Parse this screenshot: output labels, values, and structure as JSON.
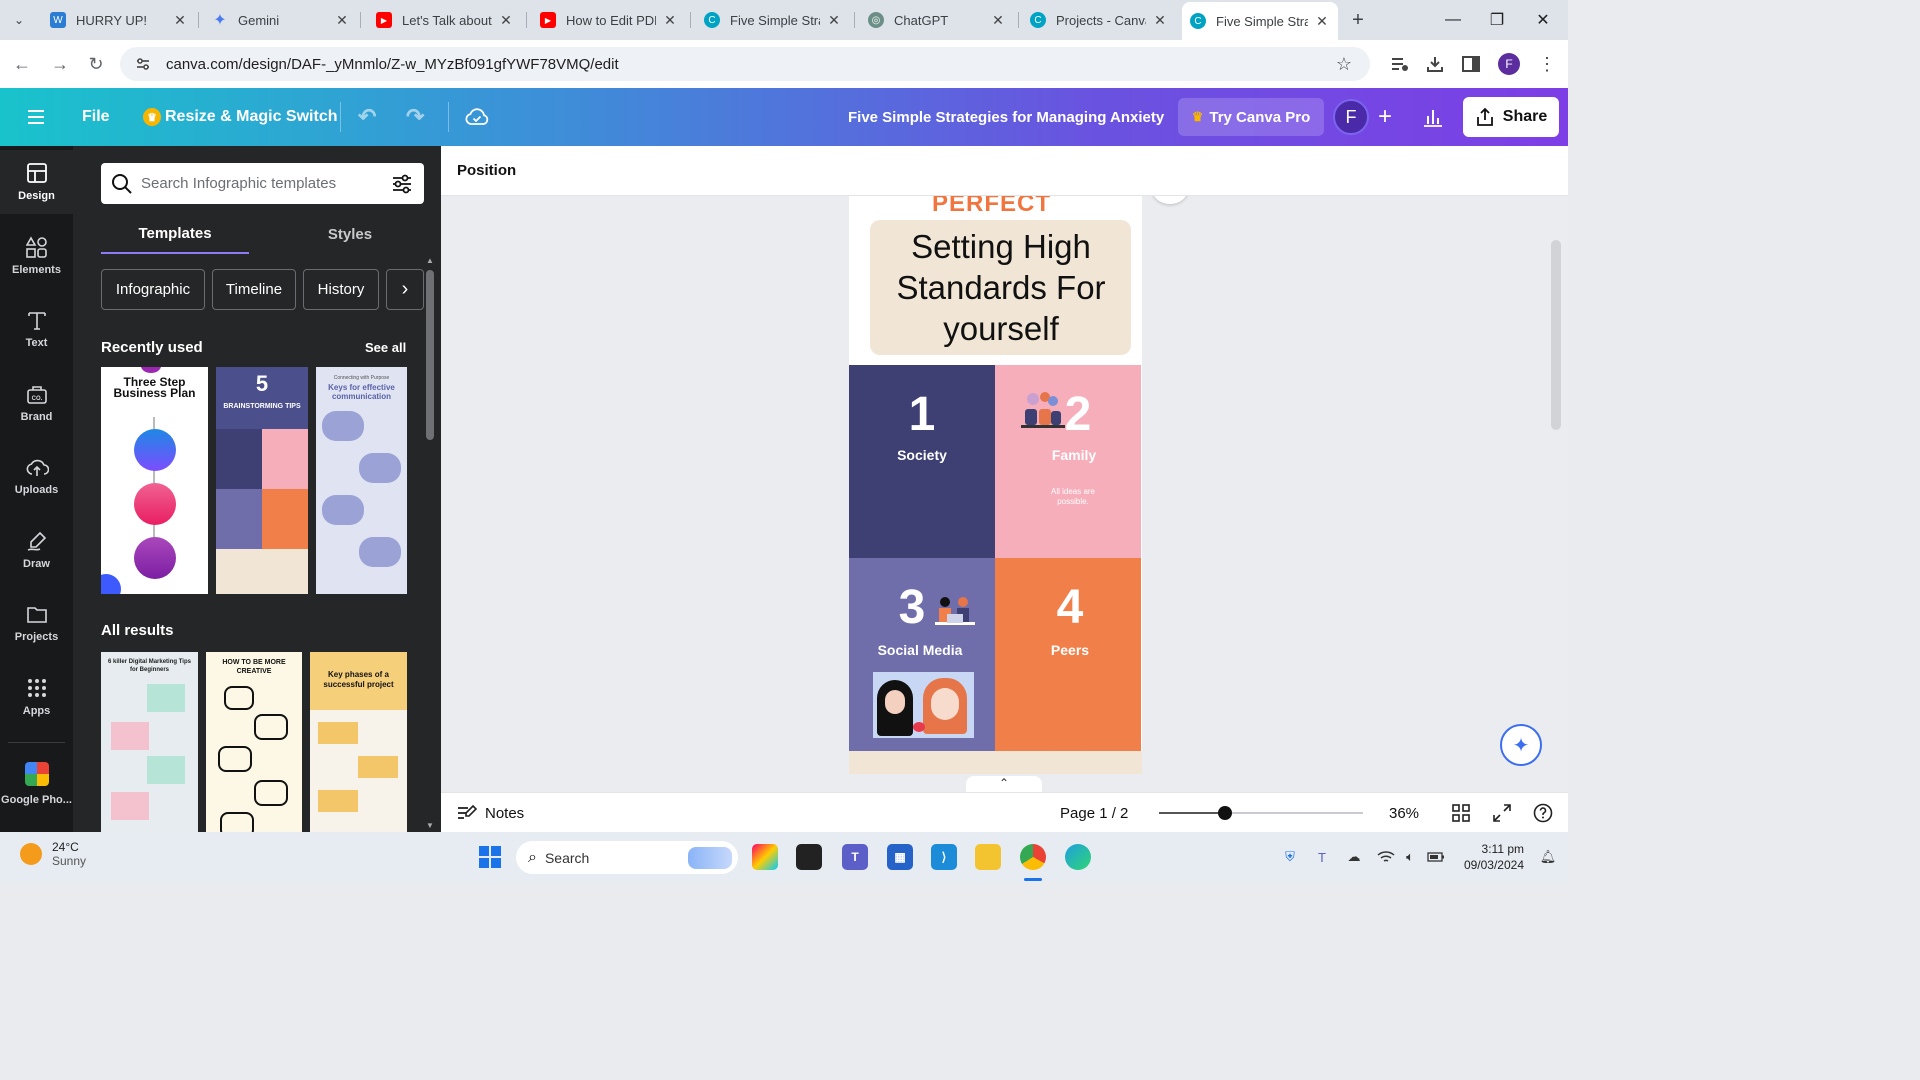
{
  "browser": {
    "tabs": [
      {
        "title": "HURRY UP!",
        "icon": "word-icon",
        "color": "#2b7cd3"
      },
      {
        "title": "Gemini",
        "icon": "gemini-icon",
        "color": "#4a7cf0"
      },
      {
        "title": "Let's Talk about",
        "icon": "youtube-icon",
        "color": "#ff0000"
      },
      {
        "title": "How to Edit PDF",
        "icon": "youtube-icon",
        "color": "#ff0000"
      },
      {
        "title": "Five Simple Strat",
        "icon": "canva-icon",
        "color": "#00a3c4"
      },
      {
        "title": "ChatGPT",
        "icon": "chatgpt-icon",
        "color": "#6b8f86"
      },
      {
        "title": "Projects - Canva",
        "icon": "canva-icon",
        "color": "#00a3c4"
      },
      {
        "title": "Five Simple Strat",
        "icon": "canva-icon",
        "color": "#00a3c4"
      }
    ],
    "url": "canva.com/design/DAF-_yMnmlo/Z-w_MYzBf091gfYWF78VMQ/edit",
    "profile_initial": "F"
  },
  "header": {
    "file": "File",
    "resize": "Resize & Magic Switch",
    "doc_title": "Five Simple Strategies for Managing Anxiety",
    "try_pro": "Try Canva Pro",
    "avatar": "F",
    "share": "Share"
  },
  "rail": [
    {
      "label": "Design",
      "icon": "design-icon"
    },
    {
      "label": "Elements",
      "icon": "elements-icon"
    },
    {
      "label": "Text",
      "icon": "text-icon"
    },
    {
      "label": "Brand",
      "icon": "brand-icon"
    },
    {
      "label": "Uploads",
      "icon": "uploads-icon"
    },
    {
      "label": "Draw",
      "icon": "draw-icon"
    },
    {
      "label": "Projects",
      "icon": "projects-icon"
    },
    {
      "label": "Apps",
      "icon": "apps-icon"
    }
  ],
  "rail_google": "Google Pho...",
  "panel": {
    "search_placeholder": "Search Infographic templates",
    "tabs": [
      "Templates",
      "Styles"
    ],
    "chips": [
      "Infographic",
      "Timeline",
      "History"
    ],
    "recent_title": "Recently used",
    "see_all": "See all",
    "all_results": "All results",
    "recent": [
      {
        "title": "Three Step Business Plan"
      },
      {
        "title": "BRAINSTORMING TIPS",
        "number": "5"
      },
      {
        "title": "Keys for effective communication",
        "subtitle": "Connecting with Purpose"
      }
    ],
    "results": [
      {
        "title": "6 killer Digital Marketing Tips for Beginners"
      },
      {
        "title": "HOW TO BE MORE CREATIVE"
      },
      {
        "title": "Key phases of a successful project"
      }
    ]
  },
  "toolbar": {
    "position": "Position"
  },
  "design": {
    "top_word": "PERFECT",
    "heading": [
      "Setting High",
      "Standards For",
      "yourself"
    ],
    "cells": [
      {
        "num": "1",
        "label": "Society",
        "color": "#3e3f72"
      },
      {
        "num": "2",
        "label": "Family",
        "color": "#f6aebb",
        "note": "All ideas are possible."
      },
      {
        "num": "3",
        "label": "Social Media",
        "color": "#6f6eaa"
      },
      {
        "num": "4",
        "label": "Peers",
        "color": "#f07f4a"
      }
    ],
    "colors": {
      "accent": "#f0753f",
      "cream": "#f1e6d6"
    }
  },
  "statusbar": {
    "notes": "Notes",
    "page": "Page 1 / 2",
    "zoom": "36%",
    "zoom_level": 0.36
  },
  "taskbar": {
    "temp": "24°C",
    "weather": "Sunny",
    "search": "Search",
    "time": "3:11 pm",
    "date": "09/03/2024"
  }
}
